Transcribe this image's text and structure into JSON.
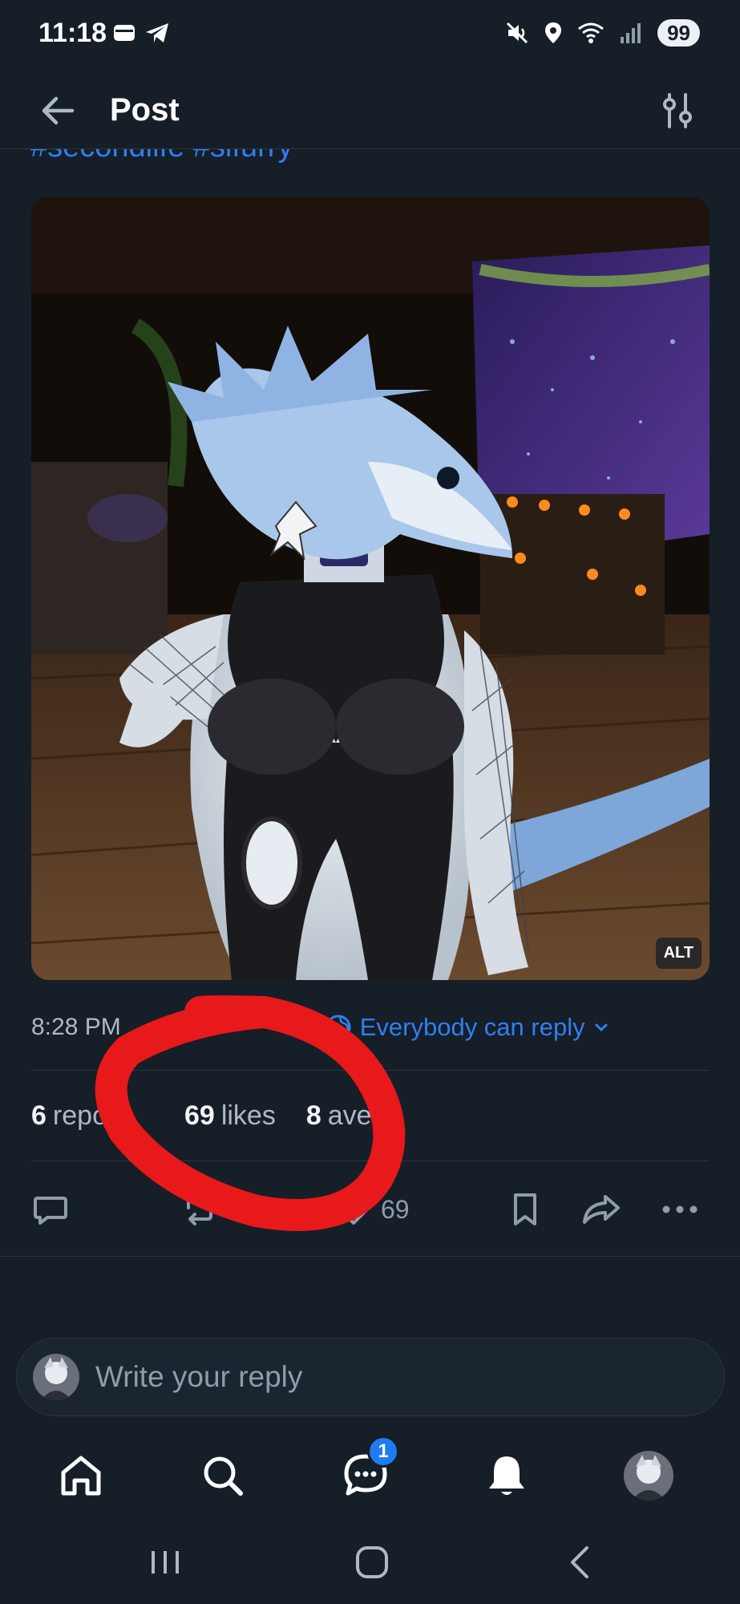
{
  "status_bar": {
    "time": "11:18",
    "battery": "99"
  },
  "header": {
    "title": "Post"
  },
  "post": {
    "hashtags": "#secondlife #slfurry",
    "image_alt_badge": "ALT",
    "timestamp": "8:28 PM",
    "reply_setting": "Everybody can reply",
    "stats": {
      "reposts_count": "6",
      "reposts_label": "repo",
      "likes_count": "69",
      "likes_label": "likes",
      "saves_count": "8",
      "saves_label": "aves"
    },
    "actions": {
      "like_count": "69"
    }
  },
  "reply": {
    "placeholder": "Write your reply"
  },
  "tabbar": {
    "messages_badge": "1"
  },
  "colors": {
    "background": "#161e27",
    "accent": "#2f7ff2",
    "muted": "#8f9cab",
    "annotation": "#e8191b"
  }
}
